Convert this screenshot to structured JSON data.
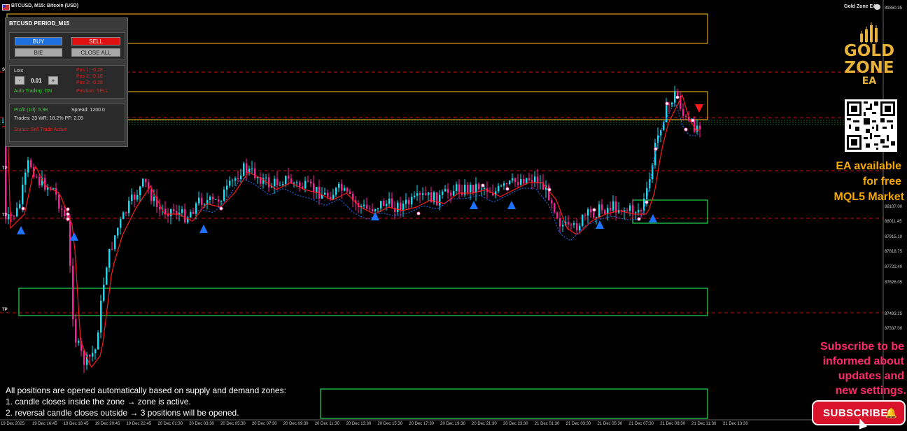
{
  "header": {
    "symbol_title": "BTCUSD, M15: Bitcoin (USD)",
    "ea_name": "Gold Zone EA"
  },
  "panel": {
    "title": "BTCUSD PERIOD_M15",
    "buy_label": "BUY",
    "sell_label": "SELL",
    "be_label": "B/E",
    "close_all_label": "CLOSE ALL",
    "lots_label": "Lots",
    "lots_value": "0.01",
    "minus_label": "-",
    "plus_label": "+",
    "auto_trading": "Auto Trading: ON",
    "pos1": "Pos 1: -0.28",
    "pos2": "Pos 2: -0.18",
    "pos3": "Pos 3: -0.28",
    "position": "Position: SELL",
    "profit": "Profit (1d): 5.98",
    "spread": "Spread: 1200.0",
    "stats": "Trades: 33  WR: 18.2%  PF: 2.05",
    "status": "Status: Sell Trade Active"
  },
  "notes": {
    "line1": "All positions are opened automatically based on supply and demand zones:",
    "line2": "1. candle closes inside the zone → zone is active.",
    "line3": "2. reversal candle closes outside → 3 positions will be opened."
  },
  "promo": {
    "logo_line1": "GOLD",
    "logo_line2": "ZONE",
    "logo_line3": "EA",
    "ea_line1": "EA available",
    "ea_line2": "for free",
    "ea_line3": "MQL5 Market",
    "sub_line1": "Subscribe to be",
    "sub_line2": "informed about",
    "sub_line3": "updates and",
    "sub_line4": "new settings.",
    "subscribe_button": "SUBSCRIBE"
  },
  "level_labels": {
    "s": "S",
    "tp1": "TP",
    "tp2": "TP",
    "tp3": "TP"
  },
  "price_axis": {
    "top": "89360.35",
    "p1": "88107.00",
    "p2": "88011.45",
    "p3": "87915.10",
    "p4": "87818.75",
    "p5": "87722.40",
    "p6": "87626.05",
    "p7": "87493.25",
    "p8": "87337.00"
  },
  "time_axis": [
    "19 Dec 2025",
    "19 Dec 16:45",
    "19 Dec 18:45",
    "19 Dec 20:45",
    "19 Dec 22:45",
    "20 Dec 01:30",
    "20 Dec 03:30",
    "20 Dec 05:30",
    "20 Dec 07:30",
    "20 Dec 09:30",
    "20 Dec 11:30",
    "20 Dec 13:30",
    "20 Dec 15:30",
    "20 Dec 17:30",
    "20 Dec 19:30",
    "20 Dec 21:30",
    "20 Dec 23:30",
    "21 Dec 01:30",
    "21 Dec 03:30",
    "21 Dec 05:30",
    "21 Dec 07:30",
    "21 Dec 09:30",
    "21 Dec 11:30",
    "21 Dec 13:30"
  ],
  "colors": {
    "bull": "#00e5ff",
    "bear": "#ff1f9e",
    "zone_supply": "#d4a017",
    "zone_demand": "#22dd55",
    "level_red": "#cc1111",
    "ma": "#ff1a1a",
    "buy_arrow": "#1e74ff",
    "sell_arrow": "#ff1a1a",
    "promo_gold": "#f5a800",
    "promo_pink": "#ff2a6a"
  }
}
